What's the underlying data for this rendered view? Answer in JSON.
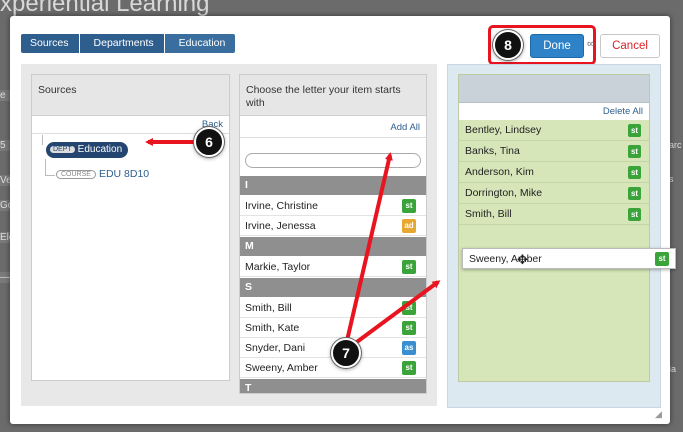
{
  "background": {
    "title": "xperiential Learning",
    "left_fragments": [
      "e",
      "5",
      "Ve",
      "Go",
      "Ele",
      "—"
    ],
    "right_fragments": [
      "arc",
      "s",
      "ia"
    ]
  },
  "breadcrumb": [
    "Sources",
    "Departments",
    "Education"
  ],
  "actions": {
    "done_label": "Done",
    "cancel_label": "Cancel"
  },
  "sources_panel": {
    "title": "Sources",
    "back_label": "Back",
    "dept_tag": "DEPT",
    "dept_name": "Education",
    "course_tag": "COURSE",
    "course_name": "EDU 8D10"
  },
  "letters_panel": {
    "title": "Choose the letter your item starts with",
    "add_all_label": "Add All",
    "search_value": "",
    "groups": [
      {
        "letter": "I",
        "items": [
          {
            "name": "Irvine, Christine",
            "badge": "st"
          },
          {
            "name": "Irvine, Jenessa",
            "badge": "ad"
          }
        ]
      },
      {
        "letter": "M",
        "items": [
          {
            "name": "Markie, Taylor",
            "badge": "st"
          }
        ]
      },
      {
        "letter": "S",
        "items": [
          {
            "name": "Smith, Bill",
            "badge": "st"
          },
          {
            "name": "Smith, Kate",
            "badge": "st"
          },
          {
            "name": "Snyder, Dani",
            "badge": "as"
          },
          {
            "name": "Sweeny, Amber",
            "badge": "st"
          }
        ]
      },
      {
        "letter": "T",
        "items": []
      }
    ]
  },
  "selected_panel": {
    "delete_all_label": "Delete All",
    "items": [
      {
        "name": "Bentley, Lindsey",
        "badge": "st"
      },
      {
        "name": "Banks, Tina",
        "badge": "st"
      },
      {
        "name": "Anderson, Kim",
        "badge": "st"
      },
      {
        "name": "Dorrington, Mike",
        "badge": "st"
      },
      {
        "name": "Smith, Bill",
        "badge": "st"
      }
    ]
  },
  "dragging_item": {
    "name": "Sweeny, Amber",
    "badge": "st"
  },
  "callouts": [
    "6",
    "7",
    "8"
  ],
  "colors": {
    "accent": "#2e5e8e",
    "done": "#2d82c8",
    "cancel": "#d9252a",
    "highlight": "#e81520",
    "selected_bg": "#d6e6b9"
  }
}
